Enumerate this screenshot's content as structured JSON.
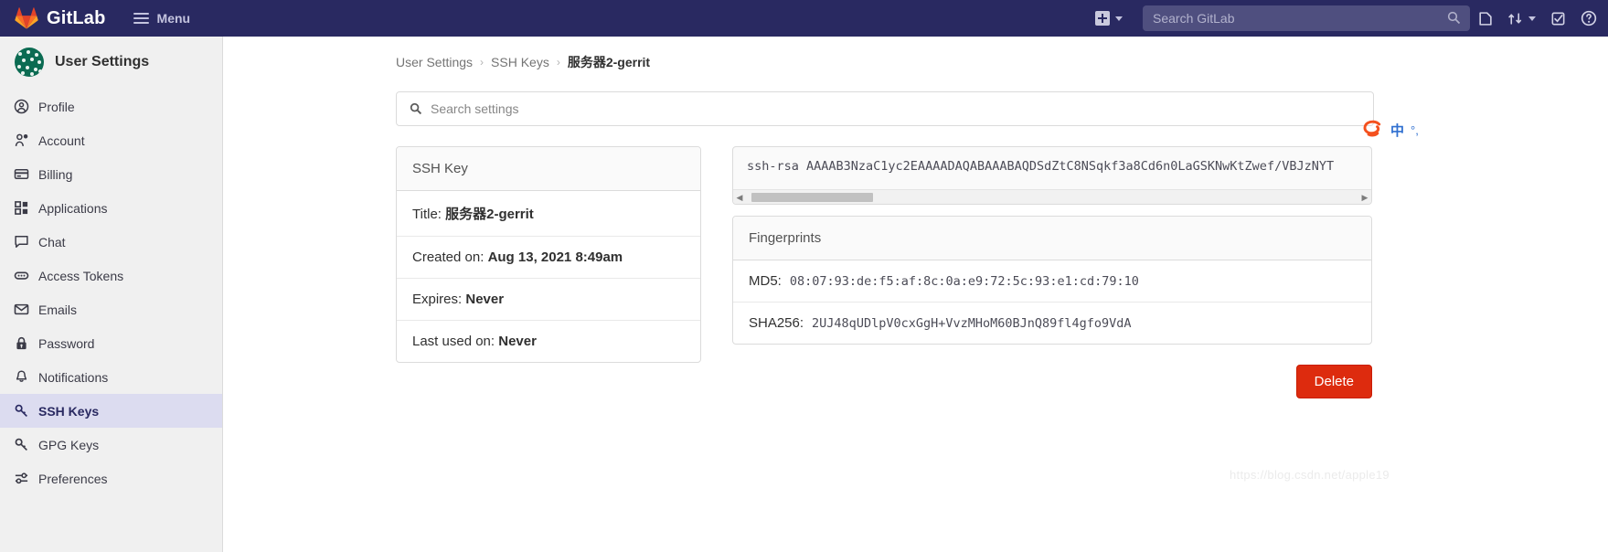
{
  "navbar": {
    "brand": "GitLab",
    "menu_label": "Menu",
    "brand_color": "#292961",
    "icons": {
      "hamburger": "hamburger-icon",
      "new": "plus-square-icon",
      "new_chevron": "chevron-down-icon",
      "search": "search-icon",
      "issues": "issues-icon",
      "merge_requests": "merge-request-icon",
      "mr_chevron": "chevron-down-icon",
      "todos": "todo-checkbox-icon",
      "help": "question-circle-icon"
    },
    "search": {
      "placeholder": "Search GitLab",
      "value": ""
    }
  },
  "sidebar": {
    "context_title": "User Settings",
    "avatar_name": "user-avatar",
    "active_item": "SSH Keys",
    "items": [
      {
        "label": "Profile",
        "icon": "profile-icon"
      },
      {
        "label": "Account",
        "icon": "account-gear-icon"
      },
      {
        "label": "Billing",
        "icon": "credit-card-icon"
      },
      {
        "label": "Applications",
        "icon": "applications-grid-icon"
      },
      {
        "label": "Chat",
        "icon": "comment-icon"
      },
      {
        "label": "Access Tokens",
        "icon": "token-icon"
      },
      {
        "label": "Emails",
        "icon": "envelope-icon"
      },
      {
        "label": "Password",
        "icon": "lock-icon"
      },
      {
        "label": "Notifications",
        "icon": "bell-icon"
      },
      {
        "label": "SSH Keys",
        "icon": "key-icon"
      },
      {
        "label": "GPG Keys",
        "icon": "key-icon"
      },
      {
        "label": "Preferences",
        "icon": "preferences-sliders-icon"
      }
    ]
  },
  "breadcrumb": {
    "items": [
      "User Settings",
      "SSH Keys"
    ],
    "current": "服务器2-gerrit",
    "separator": "›"
  },
  "settings_search": {
    "placeholder": "Search settings",
    "value": "",
    "icon": "search-icon"
  },
  "ssh_key_card": {
    "header": "SSH Key",
    "rows": [
      {
        "label": "Title:",
        "value": "服务器2-gerrit"
      },
      {
        "label": "Created on:",
        "value": "Aug 13, 2021 8:49am"
      },
      {
        "label": "Expires:",
        "value": "Never"
      },
      {
        "label": "Last used on:",
        "value": "Never"
      }
    ]
  },
  "key_content": {
    "text": "ssh-rsa AAAAB3NzaC1yc2EAAAADAQABAAABAQDSdZtC8NSqkf3a8Cd6n0LaGSKNwKtZwef/VBJzNYT",
    "scrollbar": {
      "left_arrow": "◀",
      "right_arrow": "▶"
    }
  },
  "fingerprints_card": {
    "header": "Fingerprints",
    "rows": [
      {
        "label": "MD5:",
        "value": "08:07:93:de:f5:af:8c:0a:e9:72:5c:93:e1:cd:79:10"
      },
      {
        "label": "SHA256:",
        "value": "2UJ48qUDlpV0cxGgH+VvzMHoM60BJnQ89fl4gfo9VdA"
      }
    ]
  },
  "actions": {
    "delete_label": "Delete",
    "delete_color": "#dd2b0e"
  },
  "ime_widget": {
    "logo": "sogou-logo-icon",
    "mode": "中",
    "extra": "°,"
  },
  "watermark": {
    "text": "https://blog.csdn.net/apple19"
  }
}
